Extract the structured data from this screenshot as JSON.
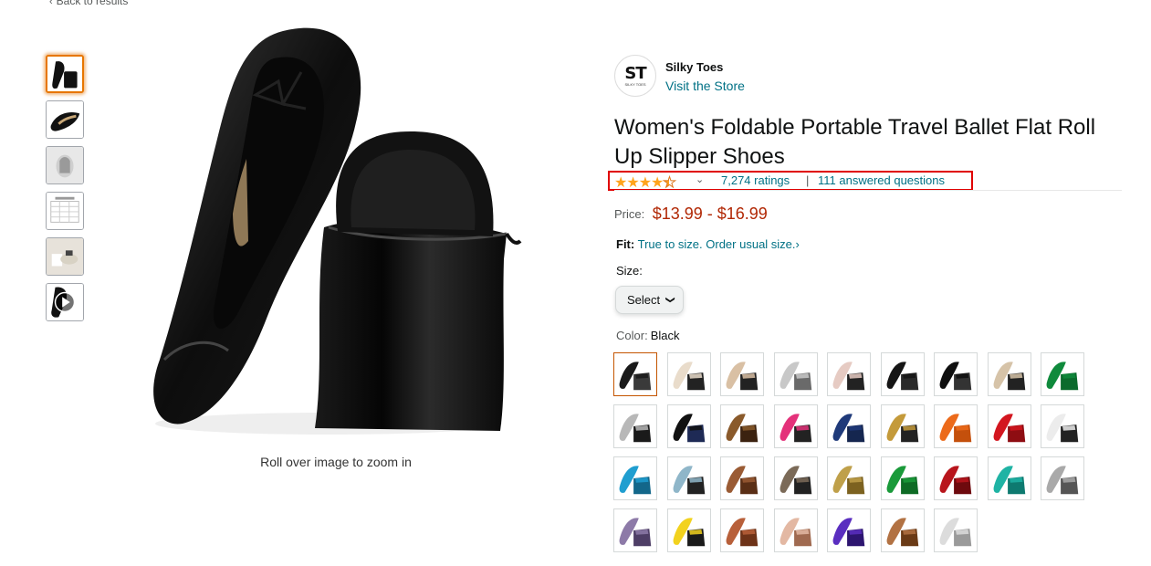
{
  "back_link": "Back to results",
  "thumbnails": [
    {
      "kind": "black-shoes",
      "active": true
    },
    {
      "kind": "single-shoe",
      "active": false
    },
    {
      "kind": "bag-silver",
      "active": false
    },
    {
      "kind": "size-chart",
      "active": false
    },
    {
      "kind": "lifestyle",
      "active": false
    },
    {
      "kind": "video",
      "active": false
    }
  ],
  "zoom_hint": "Roll over image to zoom in",
  "store": {
    "logo_main": "ST",
    "logo_sub": "SILKY TOES",
    "name": "Silky Toes",
    "link": "Visit the Store"
  },
  "product_title": "Women's Foldable Portable Travel Ballet Flat Roll Up Slipper Shoes",
  "rating": {
    "stars_value": 4.5,
    "ratings_text": "7,274 ratings",
    "separator": "|",
    "answered_text": "111 answered questions",
    "star_color": "#ffa41c"
  },
  "price": {
    "label": "Price:",
    "value": "$13.99 - $16.99",
    "color": "#b12704"
  },
  "fit": {
    "label": "Fit:",
    "text": "True to size. Order usual size.",
    "chevron": "›"
  },
  "size": {
    "label": "Size:",
    "select_text": "Select"
  },
  "color": {
    "label": "Color:",
    "value": "Black",
    "swatches": [
      {
        "name": "Black",
        "main": "#1a1a1a",
        "accent": "#3a3a3a"
      },
      {
        "name": "Champagne",
        "main": "#e9dccb",
        "accent": "#222222"
      },
      {
        "name": "Nude",
        "main": "#d9c0a4",
        "accent": "#222222"
      },
      {
        "name": "Silver",
        "main": "#c8c8c8",
        "accent": "#6a6a6a"
      },
      {
        "name": "Blush",
        "main": "#e6cbc3",
        "accent": "#222222"
      },
      {
        "name": "Black Matte",
        "main": "#151515",
        "accent": "#2a2a2a"
      },
      {
        "name": "Black Patent",
        "main": "#0f0f0f",
        "accent": "#333333"
      },
      {
        "name": "Beige",
        "main": "#d6c3a8",
        "accent": "#222222"
      },
      {
        "name": "Green",
        "main": "#0f8a3c",
        "accent": "#0b6b2d"
      },
      {
        "name": "Silver Metallic",
        "main": "#b8b8b8",
        "accent": "#1a1a1a"
      },
      {
        "name": "Black Navy",
        "main": "#111111",
        "accent": "#1e2a55"
      },
      {
        "name": "Leopard",
        "main": "#8a5a2b",
        "accent": "#3b2210"
      },
      {
        "name": "Pink",
        "main": "#e4317a",
        "accent": "#222222"
      },
      {
        "name": "Navy",
        "main": "#1f3a7a",
        "accent": "#15264f"
      },
      {
        "name": "Gold",
        "main": "#c49a3a",
        "accent": "#222222"
      },
      {
        "name": "Orange",
        "main": "#ec6a1a",
        "accent": "#c4500c"
      },
      {
        "name": "Red",
        "main": "#d3161f",
        "accent": "#8e0d12"
      },
      {
        "name": "White",
        "main": "#ececec",
        "accent": "#222222"
      },
      {
        "name": "Turquoise",
        "main": "#1f9ed0",
        "accent": "#13678a"
      },
      {
        "name": "Light Blue",
        "main": "#8fb6c9",
        "accent": "#222222"
      },
      {
        "name": "Bronze",
        "main": "#9a5b34",
        "accent": "#5a2f16"
      },
      {
        "name": "Pewter",
        "main": "#7b6a58",
        "accent": "#222222"
      },
      {
        "name": "Metallic Gold",
        "main": "#bfa04a",
        "accent": "#7c6220"
      },
      {
        "name": "Metallic Green",
        "main": "#1a9a3a",
        "accent": "#0e6b25"
      },
      {
        "name": "Deep Red",
        "main": "#b8151c",
        "accent": "#6e0a0e"
      },
      {
        "name": "Teal",
        "main": "#1fb3a4",
        "accent": "#0e7a70"
      },
      {
        "name": "Grey",
        "main": "#a9a9a9",
        "accent": "#555555"
      },
      {
        "name": "Lavender",
        "main": "#8d7aa8",
        "accent": "#4e3e66"
      },
      {
        "name": "Yellow",
        "main": "#f2d21e",
        "accent": "#1a1a1a"
      },
      {
        "name": "Copper",
        "main": "#b8603a",
        "accent": "#6e3318"
      },
      {
        "name": "Rose Gold",
        "main": "#e3b8a3",
        "accent": "#a06a50"
      },
      {
        "name": "Purple",
        "main": "#5a2ec0",
        "accent": "#2d1570"
      },
      {
        "name": "Tan",
        "main": "#b27243",
        "accent": "#6a3a16"
      },
      {
        "name": "Pearl",
        "main": "#dcdcdc",
        "accent": "#9a9a9a"
      }
    ]
  }
}
